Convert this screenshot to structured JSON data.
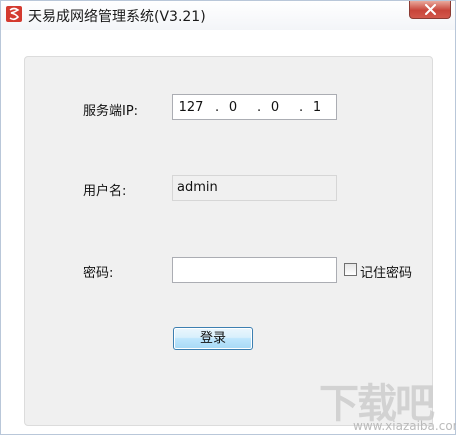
{
  "window": {
    "title": "天易成网络管理系统(V3.21)",
    "app_icon": "app-logo-icon",
    "close_icon": "close-icon"
  },
  "form": {
    "server_ip_label": "服务端IP:",
    "server_ip": {
      "seg1": "127",
      "seg2": "0",
      "seg3": "0",
      "seg4": "1",
      "separator": "."
    },
    "username_label": "用户名:",
    "username_value": "admin",
    "password_label": "密码:",
    "password_value": "",
    "remember_password_label": "记住密码",
    "remember_password_checked": false,
    "login_button": "登录"
  },
  "watermark": {
    "main": "下载吧",
    "sub": "www.xiazaiba.com"
  },
  "colors": {
    "close_button": "#c8453a",
    "login_button_border": "#3c7fb1",
    "panel_background": "#f0f0f0"
  }
}
